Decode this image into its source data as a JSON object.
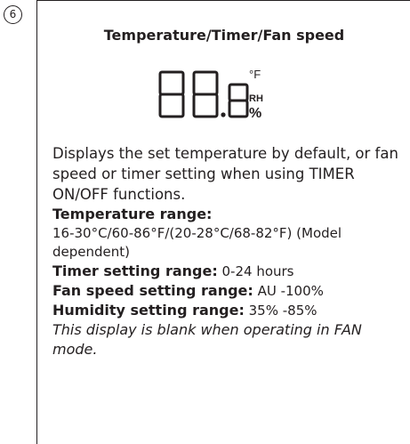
{
  "step_number": "6",
  "title": "Temperature/Timer/Fan speed",
  "display": {
    "digits": "88",
    "small_digit": "8",
    "unit_temp": "°F",
    "unit_rh": "RH",
    "unit_percent": "%"
  },
  "description": "Displays the set temperature by default, or fan speed or timer setting when using TIMER ON/OFF functions.",
  "temperature_range": {
    "label": "Temperature range:",
    "value": "16-30°C/60-86°F/(20-28°C/68-82°F) (Model dependent)"
  },
  "timer_range": {
    "label": "Timer setting range:",
    "value": " 0-24 hours"
  },
  "fan_range": {
    "label": "Fan speed setting range:",
    "value": " AU -100%"
  },
  "humidity_range": {
    "label": "Humidity setting range:",
    "value": " 35% -85%"
  },
  "note": "This display is blank when operating in FAN mode."
}
